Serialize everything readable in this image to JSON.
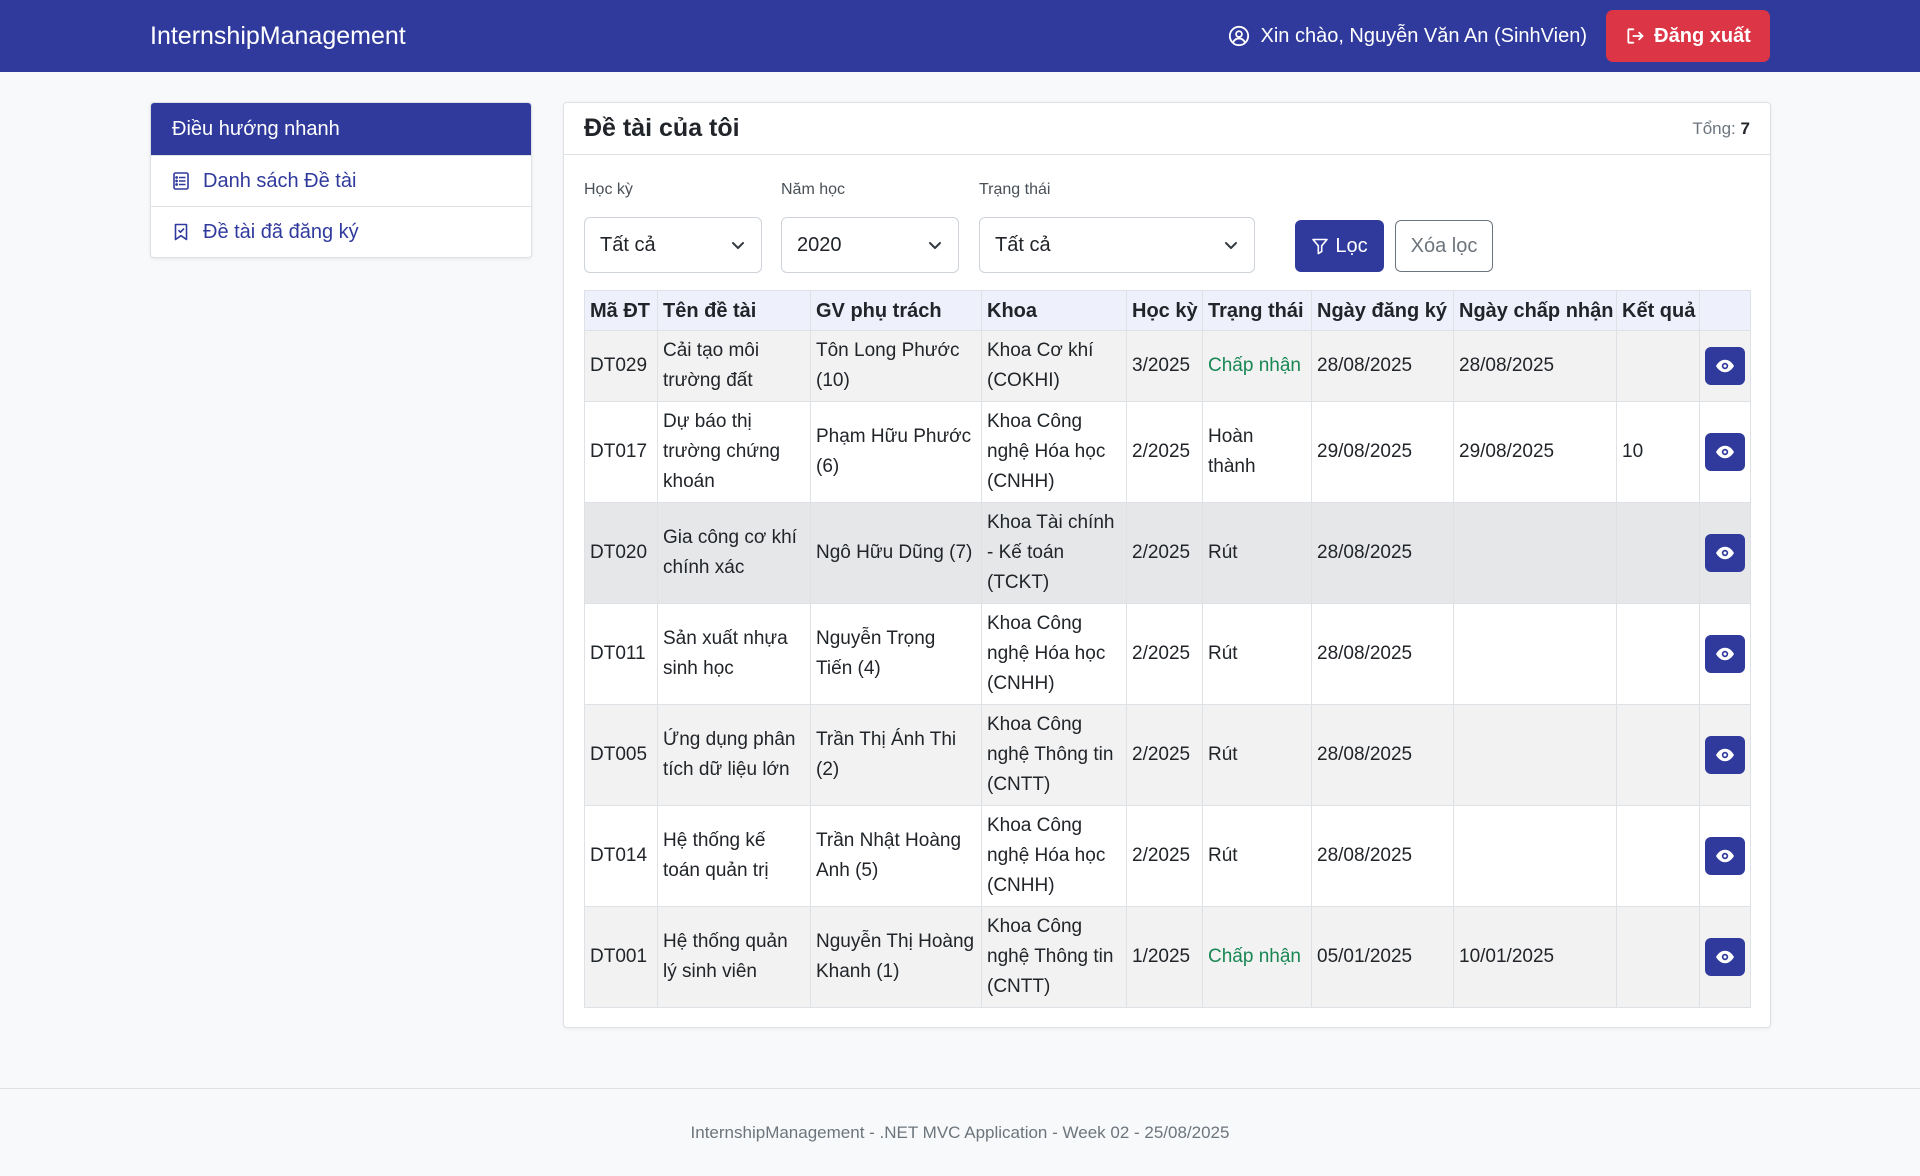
{
  "navbar": {
    "brand": "InternshipManagement",
    "greeting": "Xin chào, Nguyễn Văn An (SinhVien)",
    "logout_label": "Đăng xuất"
  },
  "sidebar": {
    "header": "Điều hướng nhanh",
    "items": [
      {
        "label": "Danh sách Đề tài",
        "icon": "list-icon"
      },
      {
        "label": "Đề tài đã đăng ký",
        "icon": "bookmark-icon"
      }
    ]
  },
  "main": {
    "title": "Đề tài của tôi",
    "total_label": "Tổng:",
    "total_value": "7",
    "filters": {
      "hocky_label": "Học kỳ",
      "hocky_value": "Tất cả",
      "namhoc_label": "Năm học",
      "namhoc_value": "2020",
      "trangthai_label": "Trạng thái",
      "trangthai_value": "Tất cả",
      "filter_button": "Lọc",
      "clear_button": "Xóa lọc"
    },
    "table": {
      "headers": [
        "Mã ĐT",
        "Tên đề tài",
        "GV phụ trách",
        "Khoa",
        "Học kỳ",
        "Trạng thái",
        "Ngày đăng ký",
        "Ngày chấp nhận",
        "Kết quả",
        ""
      ],
      "rows": [
        {
          "ma": "DT029",
          "ten": "Cải tạo môi trường đất",
          "gv": "Tôn Long Phước (10)",
          "khoa": "Khoa Cơ khí (COKHI)",
          "hocky": "3/2025",
          "trangthai": "Chấp nhận",
          "ngaydk": "28/08/2025",
          "ngaycn": "28/08/2025",
          "ketqua": ""
        },
        {
          "ma": "DT017",
          "ten": "Dự báo thị trường chứng khoán",
          "gv": "Phạm Hữu Phước (6)",
          "khoa": "Khoa Công nghệ Hóa học (CNHH)",
          "hocky": "2/2025",
          "trangthai": "Hoàn thành",
          "ngaydk": "29/08/2025",
          "ngaycn": "29/08/2025",
          "ketqua": "10"
        },
        {
          "ma": "DT020",
          "ten": "Gia công cơ khí chính xác",
          "gv": "Ngô Hữu Dũng (7)",
          "khoa": "Khoa Tài chính - Kế toán (TCKT)",
          "hocky": "2/2025",
          "trangthai": "Rút",
          "ngaydk": "28/08/2025",
          "ngaycn": "",
          "ketqua": ""
        },
        {
          "ma": "DT011",
          "ten": "Sản xuất nhựa sinh học",
          "gv": "Nguyễn Trọng Tiến (4)",
          "khoa": "Khoa Công nghệ Hóa học (CNHH)",
          "hocky": "2/2025",
          "trangthai": "Rút",
          "ngaydk": "28/08/2025",
          "ngaycn": "",
          "ketqua": ""
        },
        {
          "ma": "DT005",
          "ten": "Ứng dụng phân tích dữ liệu lớn",
          "gv": "Trần Thị Ánh Thi (2)",
          "khoa": "Khoa Công nghệ Thông tin (CNTT)",
          "hocky": "2/2025",
          "trangthai": "Rút",
          "ngaydk": "28/08/2025",
          "ngaycn": "",
          "ketqua": ""
        },
        {
          "ma": "DT014",
          "ten": "Hệ thống kế toán quản trị",
          "gv": "Trần Nhật Hoàng Anh (5)",
          "khoa": "Khoa Công nghệ Hóa học (CNHH)",
          "hocky": "2/2025",
          "trangthai": "Rút",
          "ngaydk": "28/08/2025",
          "ngaycn": "",
          "ketqua": ""
        },
        {
          "ma": "DT001",
          "ten": "Hệ thống quản lý sinh viên",
          "gv": "Nguyễn Thị Hoàng Khanh (1)",
          "khoa": "Khoa Công nghệ Thông tin (CNTT)",
          "hocky": "1/2025",
          "trangthai": "Chấp nhận",
          "ngaydk": "05/01/2025",
          "ngaycn": "10/01/2025",
          "ketqua": ""
        }
      ]
    }
  },
  "footer": {
    "text": "InternshipManagement - .NET MVC Application - Week 02 - 25/08/2025"
  },
  "colors": {
    "primary": "#303a9c",
    "danger": "#dc3545",
    "success": "#198754"
  }
}
